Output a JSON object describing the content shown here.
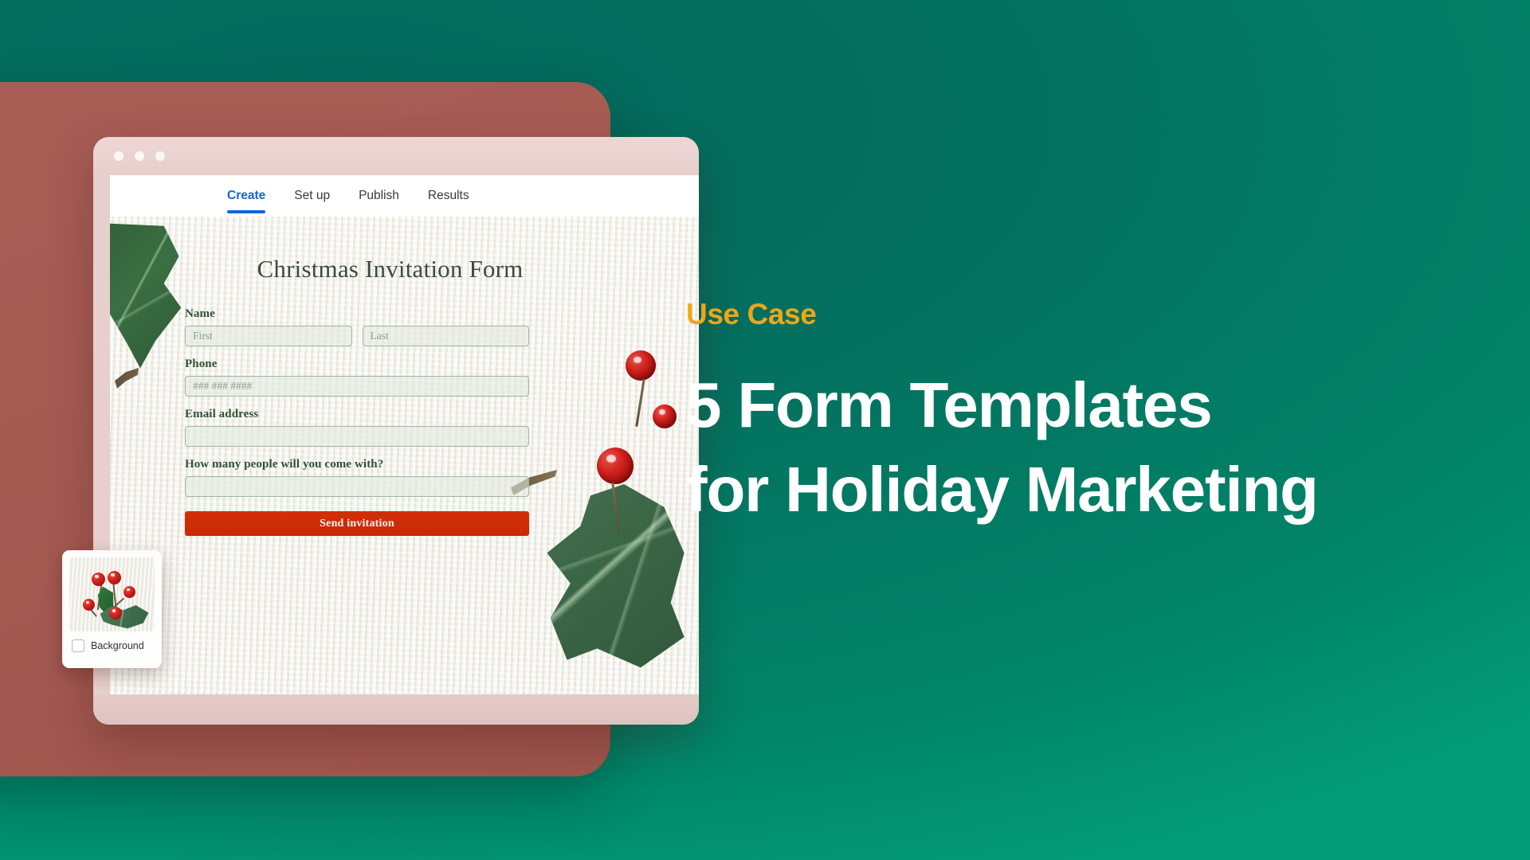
{
  "theme": {
    "background_teal": "#04705F",
    "panel_rose": "#A85E55",
    "accent_orange": "#EFA618",
    "tab_active_blue": "#1463E0",
    "submit_red": "#C92906",
    "form_green_text": "#2F5136",
    "paper_cream": "#F2F1EA"
  },
  "browser": {
    "traffic_lights": [
      "close-dot",
      "minimize-dot",
      "maximize-dot"
    ],
    "tabs": [
      {
        "label": "Create",
        "active": true
      },
      {
        "label": "Set up",
        "active": false
      },
      {
        "label": "Publish",
        "active": false
      },
      {
        "label": "Results",
        "active": false
      }
    ]
  },
  "form": {
    "title": "Christmas Invitation Form",
    "fields": [
      {
        "label": "Name",
        "type": "name-pair",
        "inputs": [
          {
            "name": "first-name",
            "placeholder": "First",
            "value": ""
          },
          {
            "name": "last-name",
            "placeholder": "Last",
            "value": ""
          }
        ]
      },
      {
        "label": "Phone",
        "type": "single",
        "inputs": [
          {
            "name": "phone",
            "placeholder": "### ### ####",
            "value": ""
          }
        ]
      },
      {
        "label": "Email address",
        "type": "single",
        "inputs": [
          {
            "name": "email",
            "placeholder": "",
            "value": ""
          }
        ]
      },
      {
        "label": "How many people will you come with?",
        "type": "single",
        "inputs": [
          {
            "name": "guest-count",
            "placeholder": "",
            "value": ""
          }
        ]
      }
    ],
    "submit_label": "Send invitation",
    "decorations": [
      "holly-leaf-top-left",
      "holly-berries-right",
      "holly-leaf-bottom-right"
    ]
  },
  "background_widget": {
    "label": "Background",
    "checked": false,
    "thumbnail": "holly-berries-thumbnail"
  },
  "marketing": {
    "eyebrow": "Use Case",
    "headline_line_1": "5 Form Templates",
    "headline_line_2": "for Holiday Marketing"
  }
}
